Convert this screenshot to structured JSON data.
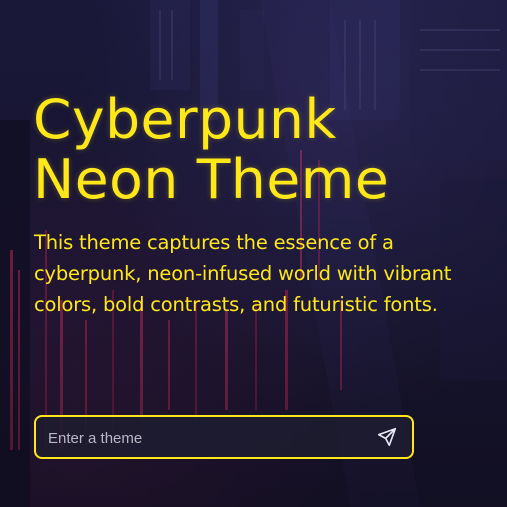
{
  "hero": {
    "title_line1": "Cyberpunk",
    "title_line2": "Neon Theme",
    "description": "This theme captures the essence of a cyberpunk, neon-infused world with vibrant colors, bold contrasts, and futuristic fonts."
  },
  "search": {
    "placeholder": "Enter a theme",
    "send_icon": "send-icon"
  },
  "colors": {
    "accent": "#ffe81a",
    "background": "#1a1733",
    "input_background": "#1e1c30"
  }
}
